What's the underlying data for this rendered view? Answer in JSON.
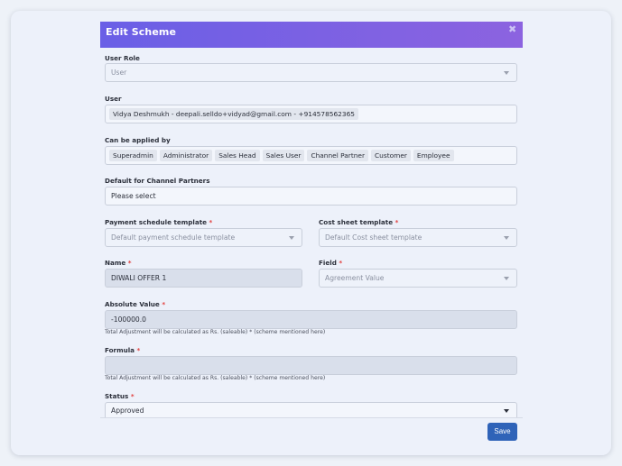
{
  "modal": {
    "title": "Edit Scheme",
    "close_glyph": "✖"
  },
  "form": {
    "user_role": {
      "label": "User Role",
      "value": "User"
    },
    "user": {
      "label": "User",
      "chip": "Vidya Deshmukh - deepali.selldo+vidyad@gmail.com - +914578562365"
    },
    "applied_by": {
      "label": "Can be applied by",
      "chips": [
        "Superadmin",
        "Administrator",
        "Sales Head",
        "Sales User",
        "Channel Partner",
        "Customer",
        "Employee"
      ]
    },
    "default_channel_partners": {
      "label": "Default for Channel Partners",
      "placeholder": "Please select"
    },
    "payment_schedule_template": {
      "label": "Payment schedule template",
      "required": "*",
      "value": "Default payment schedule template"
    },
    "cost_sheet_template": {
      "label": "Cost sheet template",
      "required": "*",
      "value": "Default Cost sheet template"
    },
    "name": {
      "label": "Name",
      "required": "*",
      "value": "DIWALI OFFER 1"
    },
    "field": {
      "label": "Field",
      "required": "*",
      "value": "Agreement Value"
    },
    "absolute_value": {
      "label": "Absolute Value",
      "required": "*",
      "value": "-100000.0",
      "hint": "Total Adjustment will be calculated as Rs. (saleable) * (scheme mentioned here)"
    },
    "formula": {
      "label": "Formula",
      "required": "*",
      "value": "",
      "hint": "Total Adjustment will be calculated as Rs. (saleable) * (scheme mentioned here)"
    },
    "status": {
      "label": "Status",
      "required": "*",
      "value": "Approved"
    }
  },
  "footer": {
    "save_label": "Save"
  },
  "colors": {
    "header_start": "#6a5fe6",
    "header_end": "#8c63e0",
    "save_button": "#2f63b8",
    "required": "#e2403e"
  },
  "icons": {
    "close": "close-icon",
    "dropdown": "chevron-down-icon"
  }
}
